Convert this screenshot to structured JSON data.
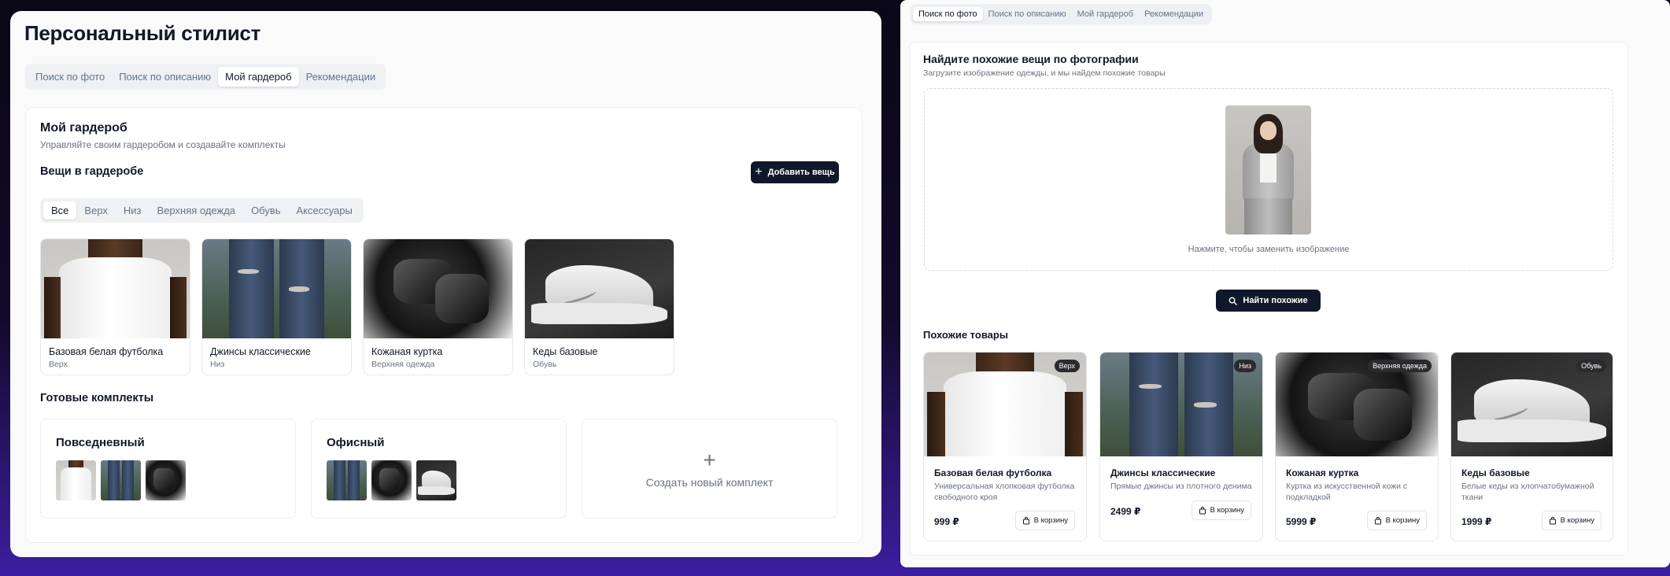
{
  "left": {
    "app_title": "Персональный стилист",
    "tabs": [
      "Поиск по фото",
      "Поиск по описанию",
      "Мой гардероб",
      "Рекомендации"
    ],
    "active_tab": "Мой гардероб",
    "wardrobe": {
      "title": "Мой гардероб",
      "subtitle": "Управляйте своим гардеробом и создавайте комплекты",
      "items_heading": "Вещи в гардеробе",
      "add_button": "Добавить вещь",
      "categories": [
        "Все",
        "Верх",
        "Низ",
        "Верхняя одежда",
        "Обувь",
        "Аксессуары"
      ],
      "active_category": "Все",
      "items": [
        {
          "name": "Базовая белая футболка",
          "category": "Верх",
          "image": "white-tshirt"
        },
        {
          "name": "Джинсы классические",
          "category": "Низ",
          "image": "ripped-jeans"
        },
        {
          "name": "Кожаная куртка",
          "category": "Верхняя одежда",
          "image": "leather-jacket"
        },
        {
          "name": "Кеды базовые",
          "category": "Обувь",
          "image": "white-sneakers"
        }
      ],
      "outfits_heading": "Готовые комплекты",
      "outfits": [
        {
          "name": "Повседневный",
          "thumbs": [
            "white-tshirt",
            "ripped-jeans",
            "leather-jacket"
          ]
        },
        {
          "name": "Офисный",
          "thumbs": [
            "ripped-jeans",
            "leather-jacket",
            "white-sneakers"
          ]
        }
      ],
      "create_outfit_label": "Создать новый комплект",
      "create_icon": "plus-icon"
    }
  },
  "right": {
    "tabs": [
      "Поиск по фото",
      "Поиск по описанию",
      "Мой гардероб",
      "Рекомендации"
    ],
    "active_tab": "Поиск по фото",
    "search": {
      "title": "Найдите похожие вещи по фотографии",
      "subtitle": "Загрузите изображение одежды, и мы найдем похожие товары",
      "uploaded_image": "woman-grey-suit",
      "replace_hint": "Нажмите, чтобы заменить изображение",
      "find_button": "Найти похожие",
      "find_icon": "search-icon"
    },
    "similar_heading": "Похожие товары",
    "products": [
      {
        "name": "Базовая белая футболка",
        "badge": "Верх",
        "description": "Универсальная хлопковая футболка свободного кроя",
        "price": "999 ₽",
        "cart_label": "В корзину",
        "image": "white-tshirt"
      },
      {
        "name": "Джинсы классические",
        "badge": "Низ",
        "description": "Прямые джинсы из плотного денима",
        "price": "2499 ₽",
        "cart_label": "В корзину",
        "image": "ripped-jeans"
      },
      {
        "name": "Кожаная куртка",
        "badge": "Верхняя одежда",
        "description": "Куртка из искусственной кожи с подкладкой",
        "price": "5999 ₽",
        "cart_label": "В корзину",
        "image": "leather-jacket"
      },
      {
        "name": "Кеды базовые",
        "badge": "Обувь",
        "description": "Белые кеды из хлопчатобумажной ткани",
        "price": "1999 ₽",
        "cart_label": "В корзину",
        "image": "white-sneakers"
      }
    ]
  },
  "colors": {
    "primary_button": "#0f172a",
    "panel_bg": "#fafafa",
    "muted_text": "#6b7280",
    "tab_bg": "#eef0f4"
  }
}
